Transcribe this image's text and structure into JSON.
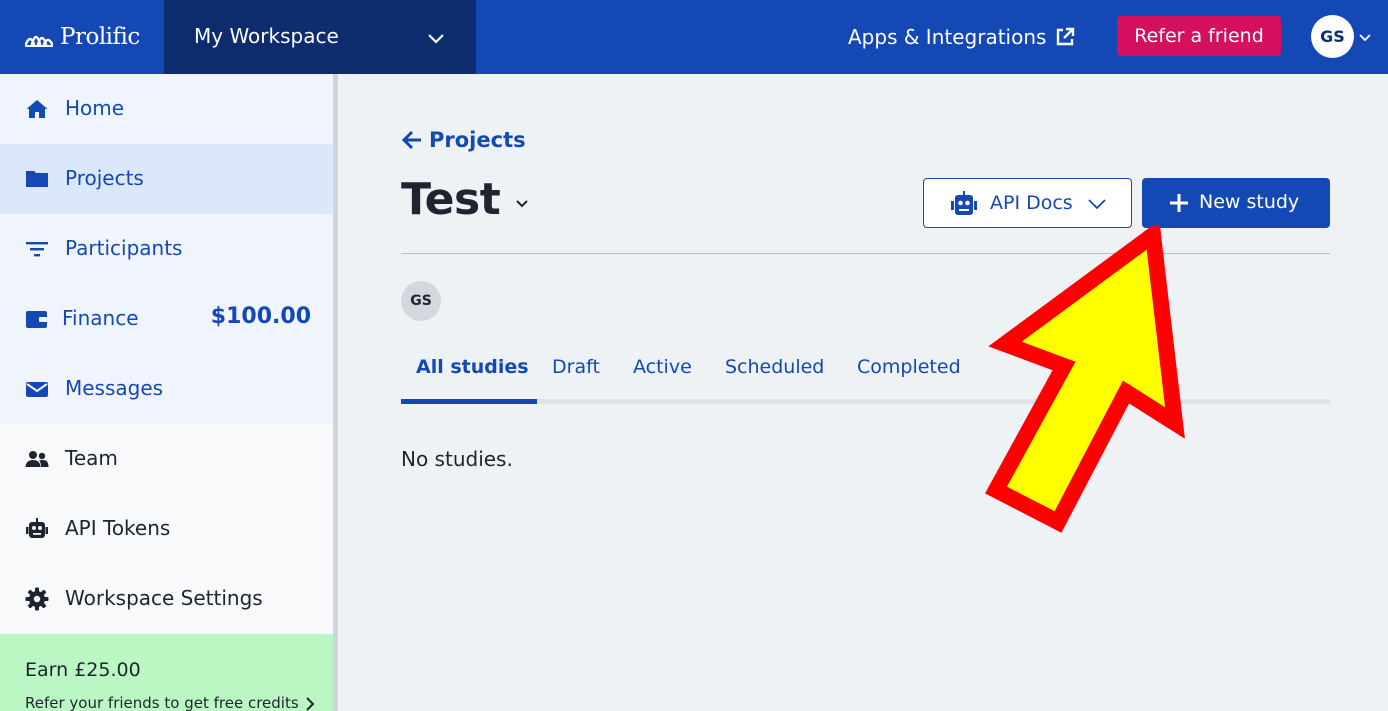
{
  "topbar": {
    "brand": "Prolific",
    "workspace": "My Workspace",
    "apps_link": "Apps & Integrations",
    "refer_button": "Refer a friend",
    "user_initials": "GS"
  },
  "sidebar": {
    "items": [
      {
        "label": "Home",
        "icon": "home-icon"
      },
      {
        "label": "Projects",
        "icon": "folder-icon"
      },
      {
        "label": "Participants",
        "icon": "filter-icon"
      },
      {
        "label": "Finance",
        "icon": "wallet-icon",
        "amount": "$100.00"
      },
      {
        "label": "Messages",
        "icon": "envelope-icon"
      },
      {
        "label": "Team",
        "icon": "team-icon"
      },
      {
        "label": "API Tokens",
        "icon": "robot-icon"
      },
      {
        "label": "Workspace Settings",
        "icon": "gear-icon"
      }
    ],
    "earn": {
      "title": "Earn £25.00",
      "subtitle": "Refer your friends to get free credits"
    }
  },
  "main": {
    "back_link": "Projects",
    "title": "Test",
    "api_docs_button": "API Docs",
    "new_study_button": "New study",
    "owner_initials": "GS",
    "tabs": [
      {
        "label": "All studies",
        "active": true
      },
      {
        "label": "Draft",
        "active": false
      },
      {
        "label": "Active",
        "active": false
      },
      {
        "label": "Scheduled",
        "active": false
      },
      {
        "label": "Completed",
        "active": false
      }
    ],
    "empty_message": "No studies."
  },
  "colors": {
    "brand_blue": "#1448b5",
    "workspace_navy": "#0c2c6e",
    "refer_pink": "#d5105e",
    "earn_green": "#bbf7c2",
    "annotation_arrow_fill": "#ffff00",
    "annotation_arrow_stroke": "#ff0000"
  }
}
